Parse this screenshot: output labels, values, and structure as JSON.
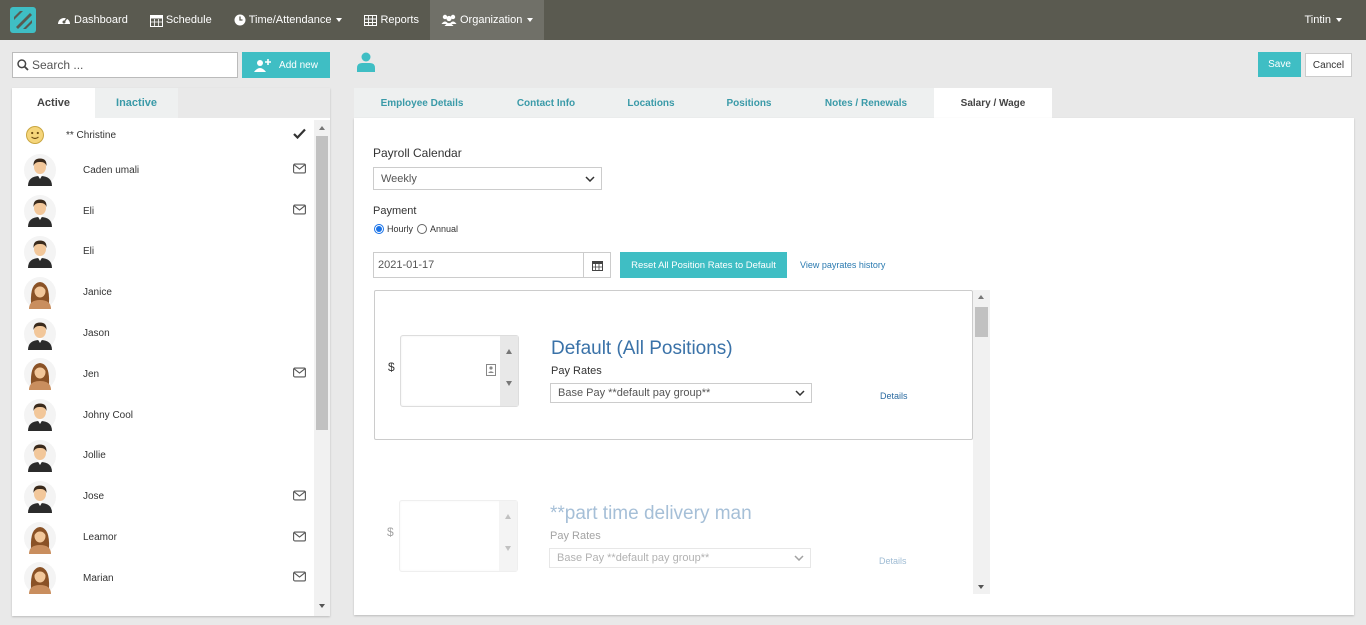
{
  "nav": {
    "items": [
      {
        "label": "Dashboard",
        "icon": "dashboard-icon"
      },
      {
        "label": "Schedule",
        "icon": "calendar-icon"
      },
      {
        "label": "Time/Attendance",
        "icon": "clock-icon"
      },
      {
        "label": "Reports",
        "icon": "table-icon"
      },
      {
        "label": "Organization",
        "icon": "users-icon"
      }
    ],
    "user": "Tintin"
  },
  "search": {
    "placeholder": "Search ...",
    "value": ""
  },
  "add_new_label": "Add new",
  "left_tabs": {
    "active": "Active",
    "inactive": "Inactive"
  },
  "employees": [
    {
      "name": "** Christine",
      "status": "check"
    },
    {
      "name": "Caden umali",
      "status": "mail"
    },
    {
      "name": "Eli",
      "status": "mail"
    },
    {
      "name": "Eli",
      "status": ""
    },
    {
      "name": "Janice",
      "status": ""
    },
    {
      "name": "Jason",
      "status": ""
    },
    {
      "name": "Jen",
      "status": "mail"
    },
    {
      "name": "Johny Cool",
      "status": ""
    },
    {
      "name": "Jollie",
      "status": ""
    },
    {
      "name": "Jose",
      "status": "mail"
    },
    {
      "name": "Leamor",
      "status": "mail"
    },
    {
      "name": "Marian",
      "status": "mail"
    }
  ],
  "actions": {
    "save": "Save",
    "cancel": "Cancel"
  },
  "tabs": [
    "Employee Details",
    "Contact Info",
    "Locations",
    "Positions",
    "Notes / Renewals",
    "Salary / Wage"
  ],
  "salary": {
    "payroll_calendar_label": "Payroll Calendar",
    "payroll_calendar_value": "Weekly",
    "payment_label": "Payment",
    "hourly_label": "Hourly",
    "annual_label": "Annual",
    "date_value": "2021-01-17",
    "reset_label": "Reset All Position Rates to Default",
    "history_label": "View payrates history",
    "rates": [
      {
        "currency": "$",
        "title": "Default (All Positions)",
        "pay_rates_label": "Pay Rates",
        "pay_group": "Base Pay **default pay group**",
        "details": "Details"
      },
      {
        "currency": "$",
        "title": "**part time delivery man",
        "pay_rates_label": "Pay Rates",
        "pay_group": "Base Pay **default pay group**",
        "details": "Details"
      }
    ]
  },
  "colors": {
    "topbar": "#5a5a50",
    "accent": "#3fbec4",
    "link": "#2a7ab0",
    "title": "#3a72a8"
  }
}
